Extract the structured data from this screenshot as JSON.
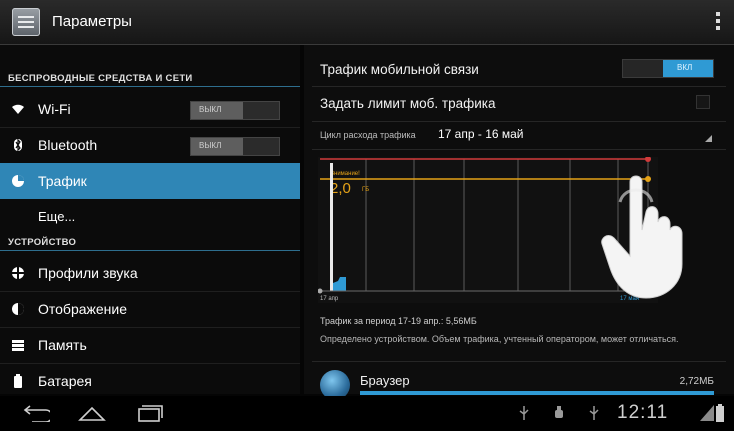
{
  "action_bar": {
    "title": "Параметры"
  },
  "sidebar": {
    "section_wireless": "БЕСПРОВОДНЫЕ СРЕДСТВА И СЕТИ",
    "section_device": "УСТРОЙСТВО",
    "items": [
      {
        "label": "Wi-Fi",
        "icon": "wifi-icon",
        "toggle": "ВЫКЛ"
      },
      {
        "label": "Bluetooth",
        "icon": "bluetooth-icon",
        "toggle": "ВЫКЛ"
      },
      {
        "label": "Трафик",
        "icon": "data-usage-icon",
        "selected": true
      },
      {
        "label": "Еще..."
      },
      {
        "label": "Профили звука",
        "icon": "sound-icon"
      },
      {
        "label": "Отображение",
        "icon": "display-icon"
      },
      {
        "label": "Память",
        "icon": "storage-icon"
      },
      {
        "label": "Батарея",
        "icon": "battery-icon"
      }
    ]
  },
  "main": {
    "mobile_traffic_label": "Трафик мобильной связи",
    "mobile_traffic_toggle": "ВКЛ",
    "limit_label": "Задать лимит моб. трафика",
    "cycle_label": "Цикл расхода трафика",
    "cycle_value": "17 апр - 16 май",
    "summary": "Трафик за период 17-19 апр.: 5,56МБ",
    "note": "Определено устройством. Объем трафика, учтенный оператором, может отличаться.",
    "apps": [
      {
        "name": "Браузер",
        "size": "2,72МБ",
        "icon": "browser-icon",
        "usage_fraction": 1.0
      }
    ]
  },
  "chart_data": {
    "type": "area",
    "x_start_label": "17 апр",
    "x_end_label": "17 мая",
    "warning_label": "Внимание!",
    "warning_value": "2,0",
    "warning_unit": "ГБ",
    "colors": {
      "limit": "#d23b3b",
      "warning": "#e6a317",
      "usage": "#2f9ad4",
      "grid": "#5a5a5a"
    }
  },
  "status_bar": {
    "time": "12:11"
  },
  "colors": {
    "accent": "#2f86b6",
    "toggle_on": "#2f9ad4"
  }
}
